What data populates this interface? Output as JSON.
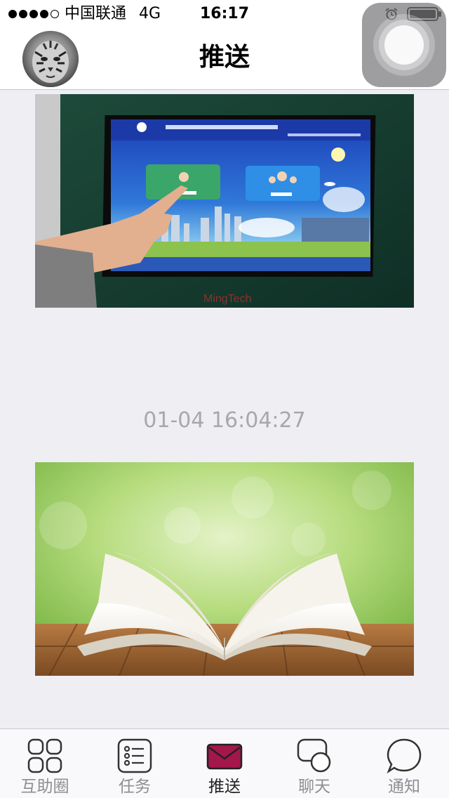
{
  "status_bar": {
    "carrier": "中国联通",
    "network": "4G",
    "time": "16:17"
  },
  "nav": {
    "title": "推送"
  },
  "feed": {
    "items": [
      {
        "type": "image",
        "subject": "social-security-kiosk-touchscreen"
      },
      {
        "type": "timestamp",
        "text": "01-04 16:04:27"
      },
      {
        "type": "image",
        "subject": "open-book-on-wooden-table"
      }
    ]
  },
  "tabs": [
    {
      "label": "互助圈",
      "icon": "grid-icon",
      "active": false
    },
    {
      "label": "任务",
      "icon": "list-icon",
      "active": false
    },
    {
      "label": "推送",
      "icon": "envelope-icon",
      "active": true
    },
    {
      "label": "聊天",
      "icon": "chat-bubbles-icon",
      "active": false
    },
    {
      "label": "通知",
      "icon": "speech-bubble-icon",
      "active": false
    }
  ],
  "colors": {
    "background": "#eeeef3",
    "active_tab_icon": "#a3174a",
    "inactive_label": "#8e8e93",
    "timestamp": "#a8a8ac"
  }
}
